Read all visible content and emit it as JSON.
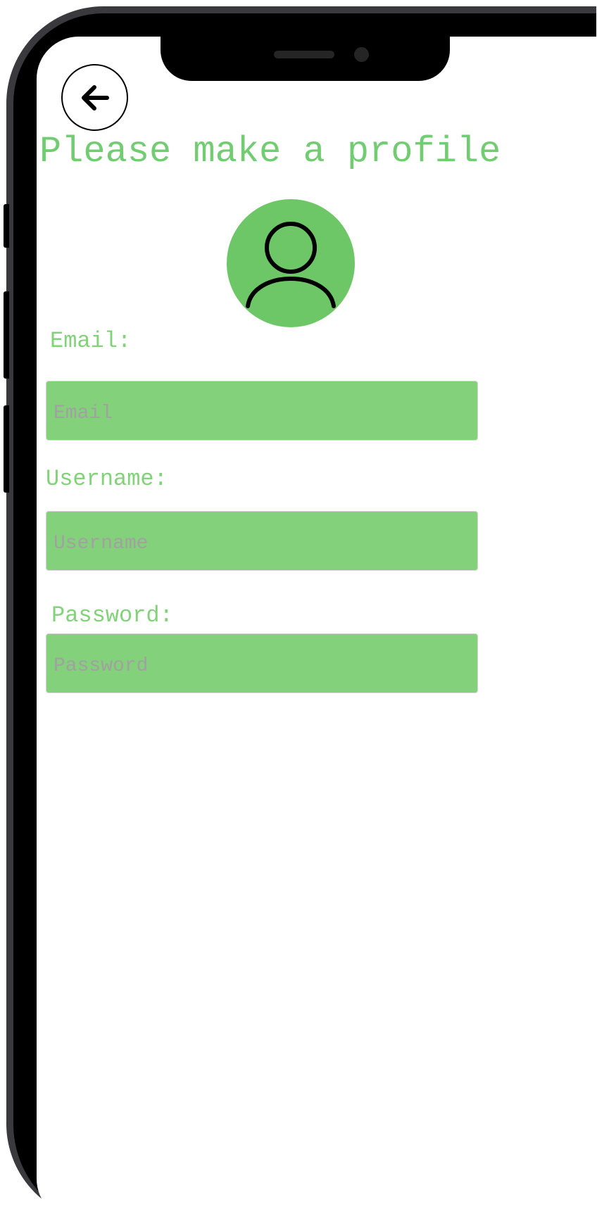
{
  "header": {
    "back_icon": "arrow-left-icon",
    "title": "Please make a profile"
  },
  "avatar": {
    "icon": "user-icon",
    "background_color": "#6ec766"
  },
  "form": {
    "email": {
      "label": "Email:",
      "placeholder": "Email",
      "value": ""
    },
    "username": {
      "label": "Username:",
      "placeholder": "Username",
      "value": ""
    },
    "password": {
      "label": "Password:",
      "placeholder": "Password",
      "value": ""
    }
  },
  "colors": {
    "accent_text": "#72cc72",
    "input_fill": "#83d17a",
    "placeholder": "#a1a1a1",
    "frame": "#3a393e"
  }
}
